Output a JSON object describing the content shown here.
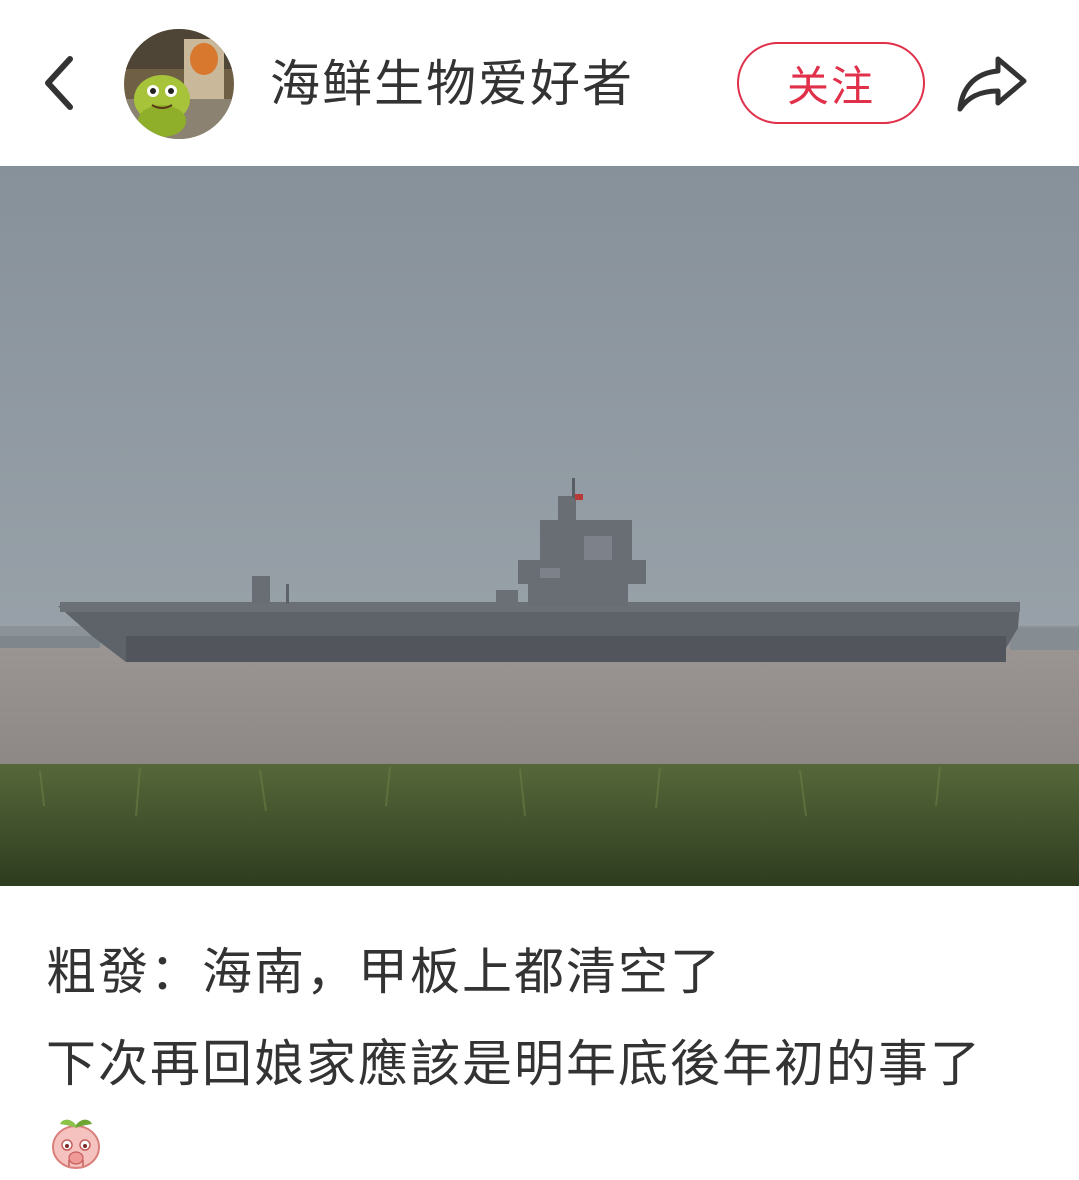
{
  "header": {
    "username": "海鲜生物爱好者",
    "follow_label": "关注",
    "back_icon": "chevron-left-icon",
    "share_icon": "share-arrow-icon"
  },
  "post": {
    "caption_line1": "粗發：海南，甲板上都清空了",
    "caption_line2": "下次再回娘家應該是明年底後年初的事了",
    "emoji": "peach-cry-emoji"
  },
  "colors": {
    "accent": "#e0304a",
    "text": "#333333",
    "background": "#ffffff"
  }
}
